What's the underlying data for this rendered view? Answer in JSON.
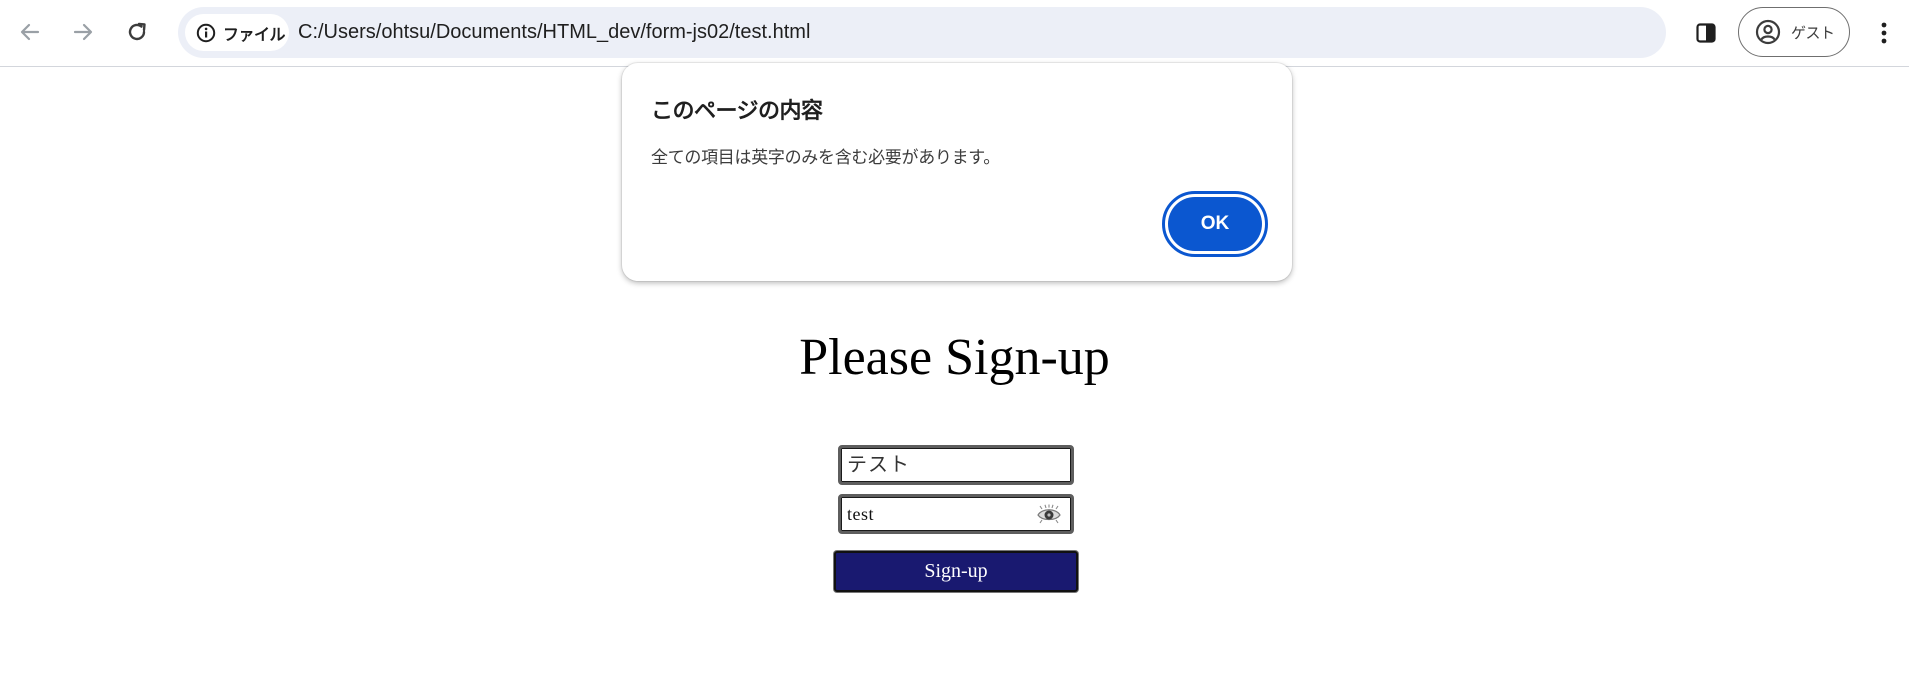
{
  "browser": {
    "site_chip_label": "ファイル",
    "url": "C:/Users/ohtsu/Documents/HTML_dev/form-js02/test.html",
    "profile_label": "ゲスト",
    "icons": {
      "back": "arrow-left-icon",
      "forward": "arrow-right-icon",
      "reload": "reload-icon",
      "info": "info-icon",
      "side_panel": "side-panel-icon",
      "profile": "person-circle-icon",
      "menu": "kebab-menu-icon"
    }
  },
  "dialog": {
    "title": "このページの内容",
    "message": "全ての項目は英字のみを含む必要があります。",
    "ok_label": "OK",
    "accent_color": "#0b57d0"
  },
  "page": {
    "title": "Please Sign-up",
    "name_value": "テスト",
    "password_value": "test",
    "password_toggle_icon": "eye-icon",
    "signup_label": "Sign-up",
    "signup_color": "#191970"
  }
}
